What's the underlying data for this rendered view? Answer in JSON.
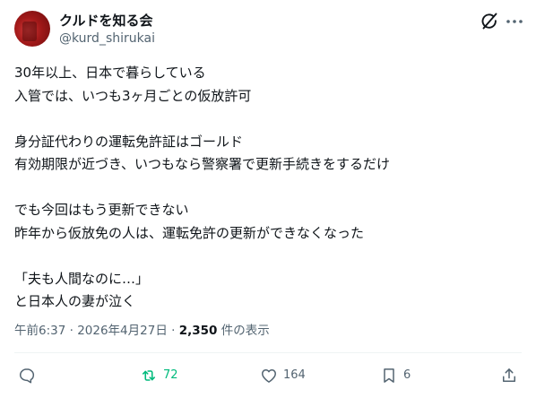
{
  "author": {
    "display_name": "クルドを知る会",
    "handle": "@kurd_shirukai"
  },
  "tweet": {
    "lines": [
      "30年以上、日本で暮らしている",
      "入管では、いつも3ヶ月ごとの仮放許可",
      "",
      "身分証代わりの運転免許証はゴールド",
      "有効期限が近づき、いつもなら警察署で更新手続きをするだけ",
      "",
      "でも今回はもう更新できない",
      "昨年から仮放免の人は、運転免許の更新ができなくなった",
      "",
      "「夫も人間なのに…」",
      "と日本人の妻が泣く"
    ]
  },
  "meta": {
    "time": "午前6:37",
    "separator": " · ",
    "date": "2026年4月27日",
    "views_count": "2,350",
    "views_label": " 件の表示"
  },
  "actions": {
    "reply_icon": "reply-icon",
    "repost_icon": "repost-icon",
    "repost_count": "72",
    "like_icon": "heart-icon",
    "like_count": "164",
    "bookmark_icon": "bookmark-icon",
    "bookmark_count": "6",
    "share_icon": "share-icon"
  },
  "colors": {
    "text": "#0f1419",
    "secondary": "#536471",
    "repost_green": "#00ba7c",
    "divider": "#eff3f4",
    "avatar_red": "#a01818"
  }
}
